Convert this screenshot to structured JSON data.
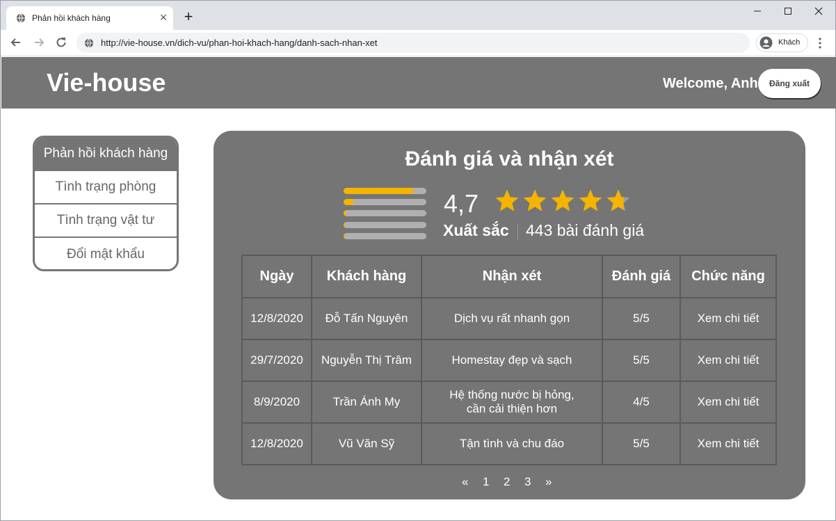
{
  "browser": {
    "tab_title": "Phản hồi khách hàng",
    "close_tab_glyph": "✕",
    "new_tab_glyph": "+",
    "url": "http://vie-house.vn/dich-vu/phan-hoi-khach-hang/danh-sach-nhan-xet",
    "profile_label": "Khách",
    "icons": [
      "globe-icon",
      "back-arrow-icon",
      "forward-arrow-icon",
      "reload-icon",
      "avatar-icon",
      "kebab-menu-icon",
      "minimize-icon",
      "maximize-icon",
      "close-icon"
    ]
  },
  "header": {
    "brand": "Vie-house",
    "welcome": "Welcome, Anh",
    "logout": "Đăng xuất"
  },
  "sidebar": {
    "items": [
      {
        "label": "Phản hồi khách hàng",
        "active": true
      },
      {
        "label": "Tình trạng phòng",
        "active": false
      },
      {
        "label": "Tình trạng vật tư",
        "active": false
      },
      {
        "label": "Đổi mật khẩu",
        "active": false
      }
    ]
  },
  "reviews": {
    "title": "Đánh giá và nhận xét",
    "score": "4,7",
    "stars_filled": 4.7,
    "rating_word": "Xuất sắc",
    "rating_count": "443 bài đánh giá",
    "distribution_fraction": [
      0.84,
      0.12,
      0.03,
      0.02,
      0.02
    ],
    "accent_color": "#f4b400",
    "panel_color": "#757575",
    "columns": [
      "Ngày",
      "Khách hàng",
      "Nhận xét",
      "Đánh giá",
      "Chức năng"
    ],
    "rows": [
      {
        "date": "12/8/2020",
        "customer": "Đỗ Tấn Nguyên",
        "comment": "Dịch vụ rất nhanh gọn",
        "score": "5/5",
        "action": "Xem chi tiết"
      },
      {
        "date": "29/7/2020",
        "customer": "Nguyễn Thị Trâm",
        "comment": "Homestay đẹp và sạch",
        "score": "5/5",
        "action": "Xem chi tiết"
      },
      {
        "date": "8/9/2020",
        "customer": "Trần Ánh My",
        "comment": "Hệ thống nước bị hỏng, cần cải thiện hơn",
        "score": "4/5",
        "action": "Xem chi tiết"
      },
      {
        "date": "12/8/2020",
        "customer": "Vũ Văn Sỹ",
        "comment": "Tận tình và chu đáo",
        "score": "5/5",
        "action": "Xem chi tiết"
      }
    ],
    "pagination": {
      "prev": "«",
      "pages": [
        "1",
        "2",
        "3"
      ],
      "next": "»"
    }
  }
}
